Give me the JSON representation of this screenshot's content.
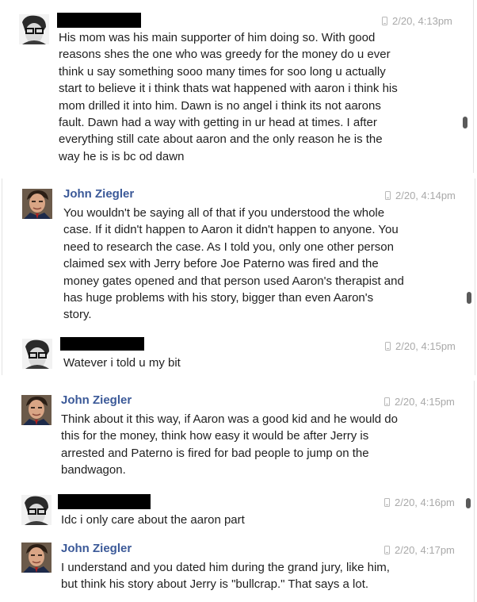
{
  "messages": [
    {
      "sender": "",
      "redacted": true,
      "time": "2/20, 4:13pm",
      "lines": [
        "His mom was his main supporter of him doing so. With good",
        "reasons shes the one who was greedy for the money do u ever",
        "think u say something sooo many times for soo long u actually",
        "start to believe it i think thats wat happened with aaron i think his",
        "mom drilled it into him. Dawn is no angel  i think its not aarons",
        "fault. Dawn had a way with getting in ur head at times. I after",
        "everything still cate about aaron and the only reason he is the",
        "way he is is bc od dawn"
      ]
    },
    {
      "sender": "John Ziegler",
      "redacted": false,
      "time": "2/20, 4:14pm",
      "lines": [
        "You wouldn't be saying all of that if you understood the whole",
        "case. If it didn't happen to Aaron it didn't happen to anyone. You",
        "need to research the case. As I told you, only one other person",
        "claimed sex with Jerry before Joe Paterno was fired and the",
        "money gates opened and that person used Aaron's therapist and",
        "has huge problems with his story, bigger than even Aaron's",
        "story."
      ]
    },
    {
      "sender": "",
      "redacted": true,
      "time": "2/20, 4:15pm",
      "lines": [
        "Watever i told u my bit"
      ]
    },
    {
      "sender": "John Ziegler",
      "redacted": false,
      "time": "2/20, 4:15pm",
      "lines": [
        "Think about it this way, if Aaron was a good kid and he would do",
        "this for the money, think how easy it would be after Jerry is",
        "arrested and Paterno is fired for bad people to jump on the",
        "bandwagon."
      ]
    },
    {
      "sender": "",
      "redacted": true,
      "time": "2/20, 4:16pm",
      "lines": [
        "Idc i only care about the aaron part"
      ]
    },
    {
      "sender": "John Ziegler",
      "redacted": false,
      "time": "2/20, 4:17pm",
      "lines": [
        "I understand and you dated him during the grand jury, like him,",
        "but think his story about Jerry is \"bullcrap.\" That says a lot."
      ]
    }
  ],
  "icons": {
    "timestamp": "mobile-phone-icon",
    "avatar_other": "avatar-photo-glasses",
    "avatar_john": "avatar-photo-john-ziegler"
  },
  "colors": {
    "sender_name": "#3b5998",
    "timestamp": "#a9a9a9",
    "redaction": "#000000"
  }
}
